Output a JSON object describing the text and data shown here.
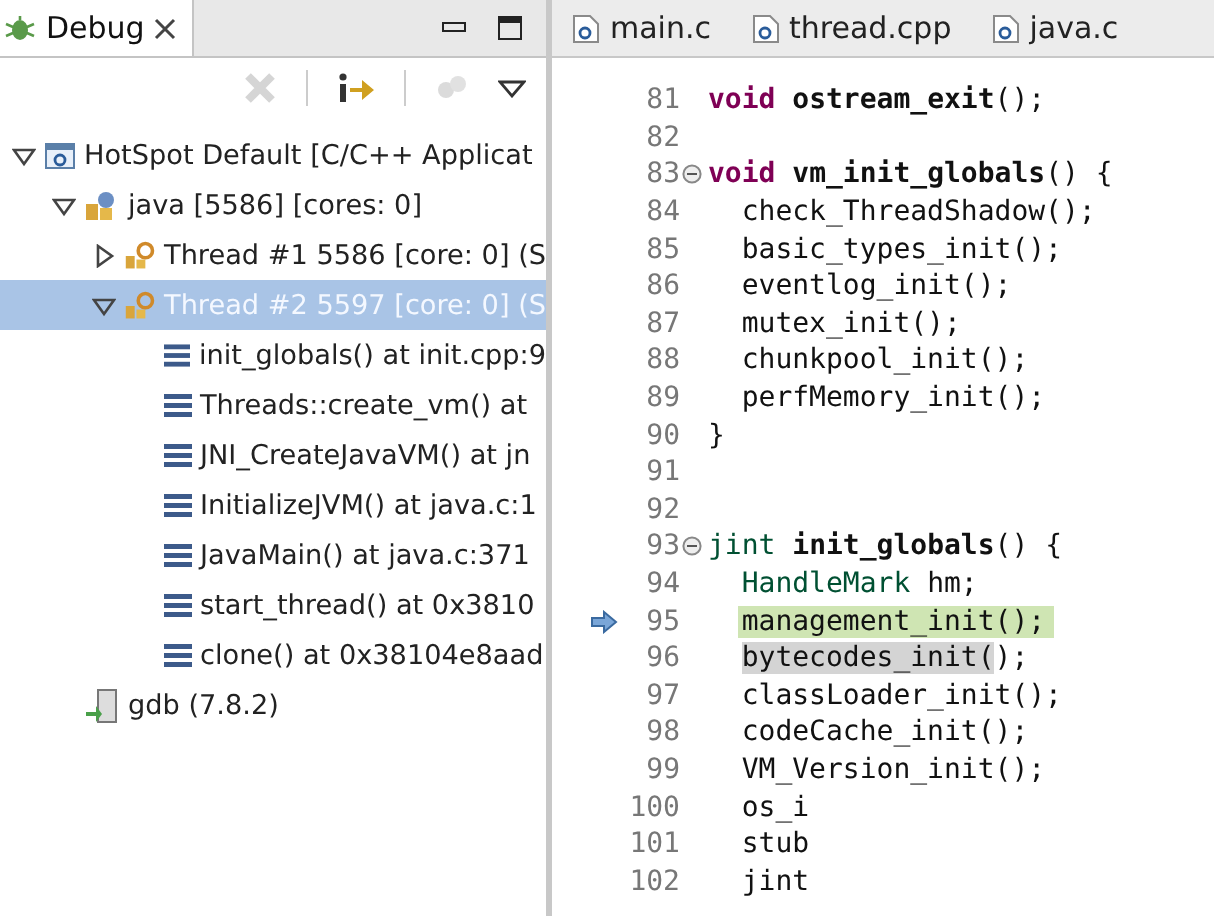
{
  "debug_view": {
    "title": "Debug",
    "toolbar": [
      {
        "kind": "remove",
        "disabled": true
      },
      {
        "kind": "step",
        "disabled": false
      },
      {
        "kind": "threads",
        "disabled": true
      },
      {
        "kind": "menu",
        "disabled": false
      }
    ],
    "tree": [
      {
        "label": "HotSpot Default [C/C++ Applicat",
        "kind": "launch",
        "expanded": true,
        "selected": false,
        "children": [
          {
            "label": "java [5586] [cores: 0]",
            "kind": "process",
            "expanded": true,
            "selected": false,
            "children": [
              {
                "label": "Thread #1 5586 [core: 0] (S",
                "kind": "thread",
                "expanded": false,
                "selected": false
              },
              {
                "label": "Thread #2 5597 [core: 0] (S",
                "kind": "thread",
                "expanded": true,
                "selected": true,
                "children": [
                  {
                    "label": "init_globals() at init.cpp:9",
                    "kind": "frame",
                    "selected": false
                  },
                  {
                    "label": "Threads::create_vm() at",
                    "kind": "frame",
                    "selected": false
                  },
                  {
                    "label": "JNI_CreateJavaVM() at jn",
                    "kind": "frame",
                    "selected": false
                  },
                  {
                    "label": "InitializeJVM() at java.c:1",
                    "kind": "frame",
                    "selected": false
                  },
                  {
                    "label": "JavaMain() at java.c:371",
                    "kind": "frame",
                    "selected": false
                  },
                  {
                    "label": "start_thread() at 0x3810",
                    "kind": "frame",
                    "selected": false
                  },
                  {
                    "label": "clone() at 0x38104e8aad",
                    "kind": "frame",
                    "selected": false
                  }
                ]
              }
            ]
          },
          {
            "label": "gdb (7.8.2)",
            "kind": "debugger",
            "selected": false
          }
        ]
      }
    ]
  },
  "editor": {
    "tabs": [
      {
        "label": "main.c"
      },
      {
        "label": "thread.cpp"
      },
      {
        "label": "java.c"
      }
    ],
    "lines": [
      {
        "number": "81",
        "fold": false,
        "current": false,
        "indented": false,
        "tokens": [
          {
            "kind": "kw",
            "text": "void"
          },
          {
            "kind": "bold",
            "text": " ostream_exit"
          },
          {
            "kind": "plain",
            "text": "();"
          }
        ]
      },
      {
        "number": "82",
        "fold": false,
        "current": false
      },
      {
        "number": "83",
        "fold": true,
        "current": false,
        "indented": false,
        "tokens": [
          {
            "kind": "kw",
            "text": "void"
          },
          {
            "kind": "bold",
            "text": " vm_init_globals"
          },
          {
            "kind": "plain",
            "text": "() {"
          }
        ]
      },
      {
        "number": "84",
        "fold": false,
        "current": false,
        "indented": true,
        "tokens": [
          {
            "kind": "plain",
            "text": "check_ThreadShadow();"
          }
        ]
      },
      {
        "number": "85",
        "fold": false,
        "current": false,
        "indented": true,
        "tokens": [
          {
            "kind": "plain",
            "text": "basic_types_init();"
          }
        ]
      },
      {
        "number": "86",
        "fold": false,
        "current": false,
        "indented": true,
        "tokens": [
          {
            "kind": "plain",
            "text": "eventlog_init();"
          }
        ]
      },
      {
        "number": "87",
        "fold": false,
        "current": false,
        "indented": true,
        "tokens": [
          {
            "kind": "plain",
            "text": "mutex_init();"
          }
        ]
      },
      {
        "number": "88",
        "fold": false,
        "current": false,
        "indented": true,
        "tokens": [
          {
            "kind": "plain",
            "text": "chunkpool_init();"
          }
        ]
      },
      {
        "number": "89",
        "fold": false,
        "current": false,
        "indented": true,
        "tokens": [
          {
            "kind": "plain",
            "text": "perfMemory_init();"
          }
        ]
      },
      {
        "number": "90",
        "fold": false,
        "current": false,
        "indented": false,
        "tokens": [
          {
            "kind": "plain",
            "text": "}"
          }
        ]
      },
      {
        "number": "91",
        "fold": false,
        "current": false
      },
      {
        "number": "92",
        "fold": false,
        "current": false
      },
      {
        "number": "93",
        "fold": true,
        "current": false,
        "indented": false,
        "tokens": [
          {
            "kind": "type",
            "text": "jint"
          },
          {
            "kind": "bold",
            "text": " init_globals"
          },
          {
            "kind": "plain",
            "text": "() {"
          }
        ]
      },
      {
        "number": "94",
        "fold": false,
        "current": false,
        "indented": true,
        "tokens": [
          {
            "kind": "type",
            "text": "HandleMark"
          },
          {
            "kind": "plain",
            "text": " hm;"
          }
        ]
      },
      {
        "number": "95",
        "fold": false,
        "current": true,
        "indented": true,
        "tokens": [
          {
            "kind": "plain",
            "text": "management_init();"
          }
        ]
      },
      {
        "number": "96",
        "fold": false,
        "current": false,
        "indented": true,
        "tokens": [
          {
            "kind": "mark",
            "text": "bytecodes_init("
          },
          {
            "kind": "plain",
            "text": ");"
          }
        ]
      },
      {
        "number": "97",
        "fold": false,
        "current": false,
        "indented": true,
        "tokens": [
          {
            "kind": "plain",
            "text": "classLoader_init();"
          }
        ]
      },
      {
        "number": "98",
        "fold": false,
        "current": false,
        "indented": true,
        "tokens": [
          {
            "kind": "plain",
            "text": "codeCache_init();"
          }
        ]
      },
      {
        "number": "99",
        "fold": false,
        "current": false,
        "indented": true,
        "tokens": [
          {
            "kind": "plain",
            "text": "VM_Version_init();"
          }
        ]
      },
      {
        "number": "100",
        "fold": false,
        "current": false,
        "indented": true,
        "tokens": [
          {
            "kind": "plain",
            "text": "os_i"
          }
        ]
      },
      {
        "number": "101",
        "fold": false,
        "current": false,
        "indented": true,
        "tokens": [
          {
            "kind": "plain",
            "text": "stub"
          }
        ]
      },
      {
        "number": "102",
        "fold": false,
        "current": false,
        "indented": true,
        "tokens": [
          {
            "kind": "plain",
            "text": "jint"
          }
        ]
      }
    ]
  }
}
